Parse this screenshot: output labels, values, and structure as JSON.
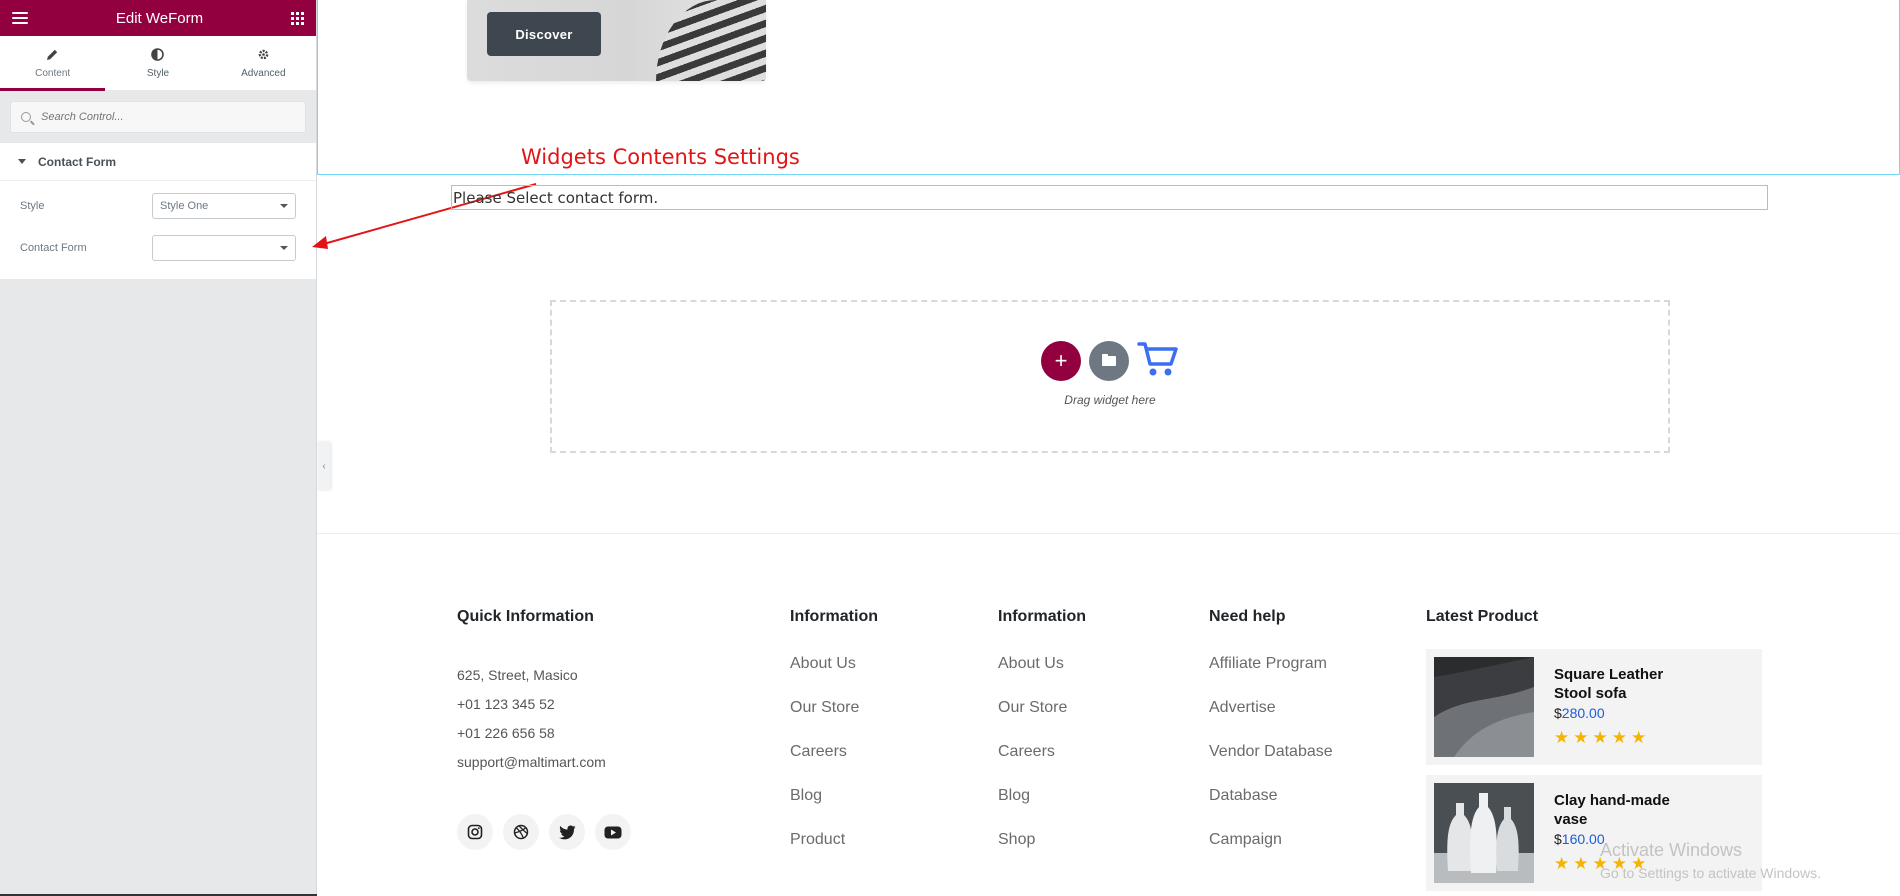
{
  "panel": {
    "title": "Edit WeForm",
    "tabs": [
      {
        "label": "Content",
        "icon": "pencil-icon"
      },
      {
        "label": "Style",
        "icon": "half-circle-icon"
      },
      {
        "label": "Advanced",
        "icon": "gear-icon"
      }
    ],
    "search_placeholder": "Search Control...",
    "section_title": "Contact Form",
    "controls": {
      "style_label": "Style",
      "style_value": "Style One",
      "contact_form_label": "Contact Form",
      "contact_form_value": ""
    },
    "accent_color": "#93003f"
  },
  "canvas": {
    "hero_button": "Discover",
    "annotation": "Widgets Contents Settings",
    "notice": "Please Select contact form.",
    "dropzone_text": "Drag widget here"
  },
  "footer": {
    "quick_info": {
      "title": "Quick Information",
      "lines": [
        "625, Street, Masico",
        "+01 123 345 52",
        "+01 226 656 58",
        "support@maltimart.com"
      ],
      "socials": [
        "instagram-icon",
        "dribbble-icon",
        "twitter-icon",
        "youtube-icon"
      ]
    },
    "col1": {
      "title": "Information",
      "links": [
        "About Us",
        "Our Store",
        "Careers",
        "Blog",
        "Product"
      ]
    },
    "col2": {
      "title": "Information",
      "links": [
        "About Us",
        "Our Store",
        "Careers",
        "Blog",
        "Shop"
      ]
    },
    "col3": {
      "title": "Need help",
      "links": [
        "Affiliate Program",
        "Advertise",
        "Vendor Database",
        "Database",
        "Campaign"
      ]
    },
    "latest": {
      "title": "Latest Product",
      "products": [
        {
          "title": "Square Leather Stool sofa",
          "currency": "$",
          "price": "280.00",
          "rating": 5
        },
        {
          "title": "Clay hand-made vase",
          "currency": "$",
          "price": "160.00",
          "rating": 5
        }
      ]
    }
  },
  "watermark": {
    "line1": "Activate Windows",
    "line2": "Go to Settings to activate Windows."
  }
}
